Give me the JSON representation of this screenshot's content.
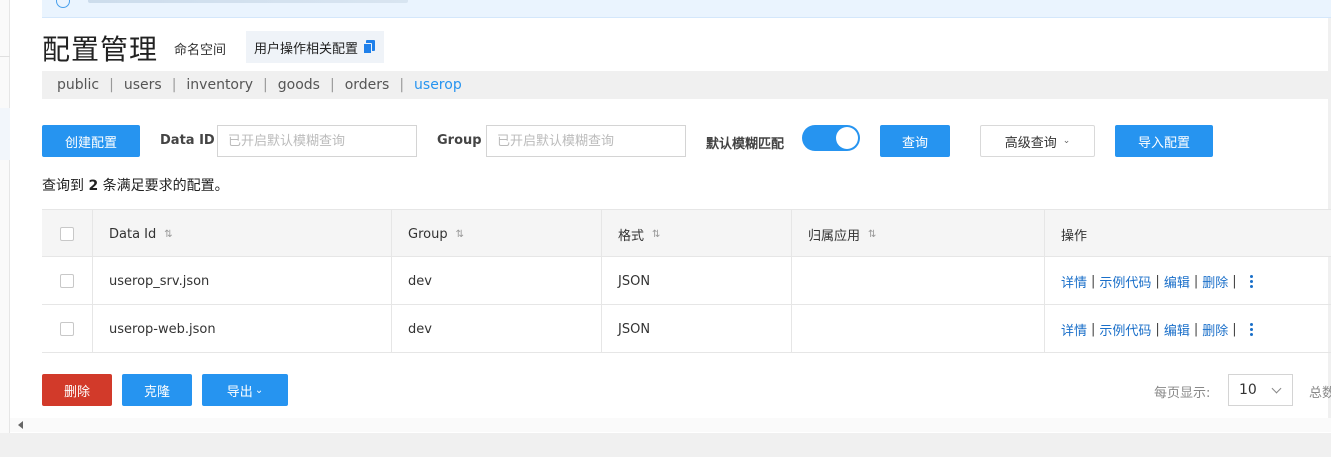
{
  "page": {
    "title": "配置管理",
    "namespace_label": "命名空间",
    "namespace_value": "用户操作相关配置"
  },
  "namespaces": {
    "items": [
      "public",
      "users",
      "inventory",
      "goods",
      "orders",
      "userop"
    ],
    "active": "userop"
  },
  "toolbar": {
    "create_label": "创建配置",
    "data_id_label": "Data ID",
    "data_id_placeholder": "已开启默认模糊查询",
    "group_label": "Group",
    "group_placeholder": "已开启默认模糊查询",
    "fuzzy_label": "默认模糊匹配",
    "fuzzy_on": true,
    "query_label": "查询",
    "advanced_label": "高级查询",
    "import_label": "导入配置"
  },
  "result": {
    "prefix": "查询到",
    "count": "2",
    "suffix": "条满足要求的配置。"
  },
  "table": {
    "headers": [
      "Data Id",
      "Group",
      "格式",
      "归属应用",
      "操作"
    ],
    "rows": [
      {
        "data_id": "userop_srv.json",
        "group": "dev",
        "format": "JSON",
        "app": ""
      },
      {
        "data_id": "userop-web.json",
        "group": "dev",
        "format": "JSON",
        "app": ""
      }
    ],
    "actions": [
      "详情",
      "示例代码",
      "编辑",
      "删除"
    ]
  },
  "footer": {
    "delete_label": "删除",
    "clone_label": "克隆",
    "export_label": "导出",
    "page_size_label": "每页显示:",
    "page_size": "10",
    "total_label": "总数"
  },
  "colors": {
    "primary": "#2694f0",
    "danger": "#d23a2a",
    "link": "#1a6fc9"
  }
}
